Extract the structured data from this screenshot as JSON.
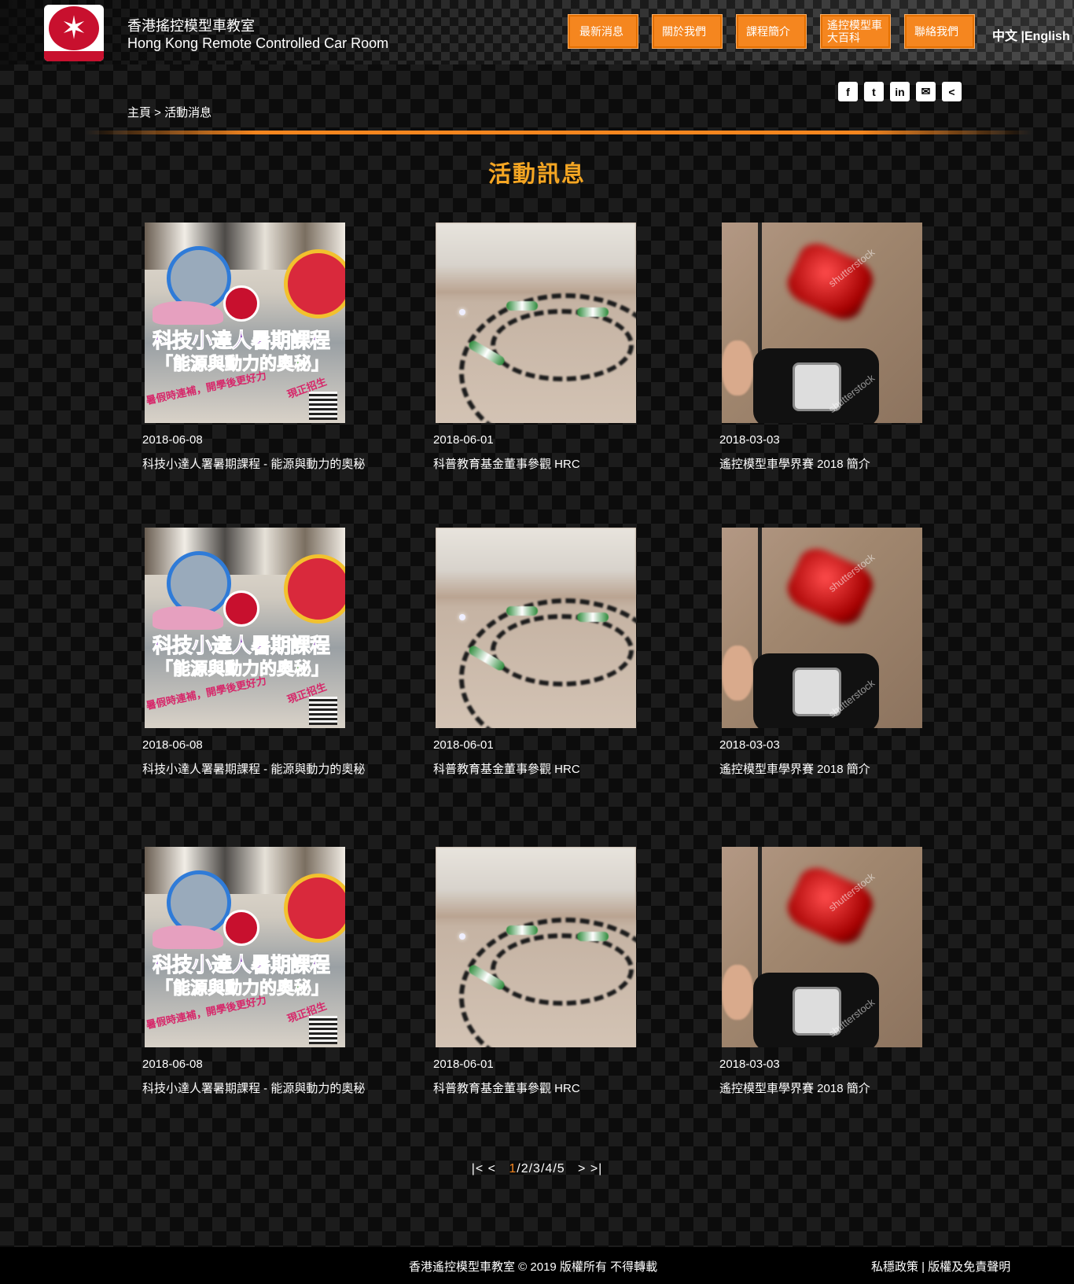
{
  "header": {
    "title_zh": "香港搖控模型車教室",
    "title_en": "Hong Kong Remote Controlled Car Room",
    "nav": [
      {
        "label": "最新消息"
      },
      {
        "label": "關於我們"
      },
      {
        "label": "課程簡介"
      },
      {
        "label": "遙控模型車大百科"
      },
      {
        "label": "聯絡我們"
      }
    ],
    "lang_zh": "中文",
    "lang_sep": " |",
    "lang_en": "English"
  },
  "social": [
    "f",
    "t",
    "in",
    "✉",
    "<"
  ],
  "breadcrumb": {
    "home": "主頁",
    "sep": " > ",
    "current": "活動消息"
  },
  "page_title": "活動訊息",
  "news": [
    {
      "date": "2018-06-08",
      "title": "科技小達人署暑期課程 - 能源與動力的奧秘",
      "thumb": "poster"
    },
    {
      "date": "2018-06-01",
      "title": "科普教育基金董事參觀 HRC",
      "thumb": "track"
    },
    {
      "date": "2018-03-03",
      "title": "遙控模型車學界賽 2018 簡介",
      "thumb": "rccar"
    },
    {
      "date": "2018-06-08",
      "title": "科技小達人署暑期課程 - 能源與動力的奧秘",
      "thumb": "poster"
    },
    {
      "date": "2018-06-01",
      "title": "科普教育基金董事參觀 HRC",
      "thumb": "track"
    },
    {
      "date": "2018-03-03",
      "title": "遙控模型車學界賽 2018 簡介",
      "thumb": "rccar"
    },
    {
      "date": "2018-06-08",
      "title": "科技小達人署暑期課程 - 能源與動力的奧秘",
      "thumb": "poster"
    },
    {
      "date": "2018-06-01",
      "title": "科普教育基金董事參觀 HRC",
      "thumb": "track"
    },
    {
      "date": "2018-03-03",
      "title": "遙控模型車學界賽 2018 簡介",
      "thumb": "rccar"
    }
  ],
  "poster_text": {
    "line1": "科技小達人暑期課程",
    "line2": "「能源與動力的奧秘」",
    "line3": "暑假時連補，開學後更好力",
    "line4": "現正招生"
  },
  "watermark": "shutterstock",
  "pagination": {
    "first": "|<",
    "prev": "<",
    "pages": [
      "1",
      "2",
      "3",
      "4",
      "5"
    ],
    "next": ">",
    "last": ">|",
    "current": "1"
  },
  "footer": {
    "copyright": "香港遙控模型車教室 © 2019 版權所有 不得轉載",
    "privacy": "私穩政策",
    "sep": " | ",
    "disclaimer": "版權及免責聲明"
  },
  "colors": {
    "accent": "#f5861f",
    "title": "#f5a623"
  }
}
